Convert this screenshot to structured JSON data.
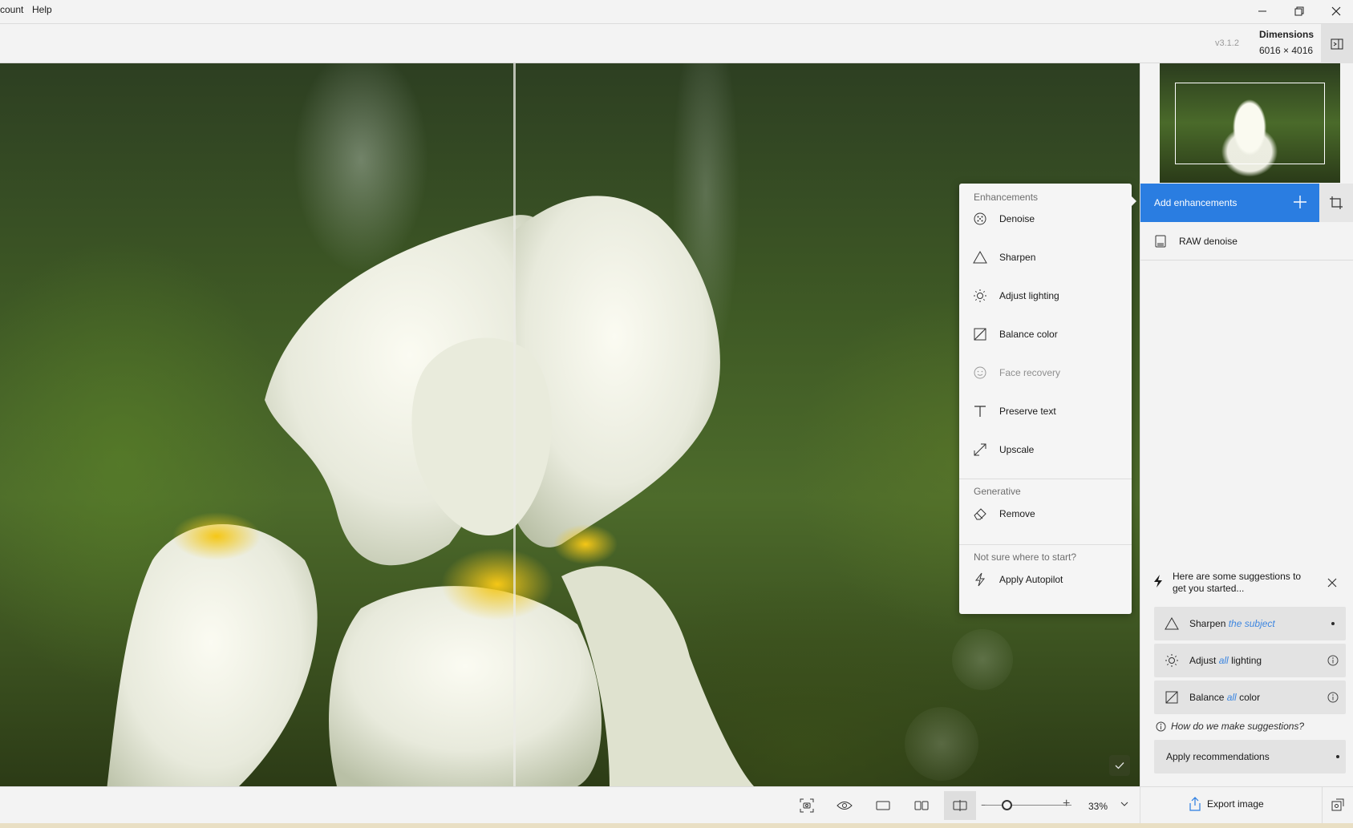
{
  "menubar": {
    "items": [
      "count",
      "Help"
    ]
  },
  "toolbar": {
    "version": "v3.1.2",
    "dimensions_title": "Dimensions",
    "dimensions_value": "6016 × 4016"
  },
  "enhancements_menu": {
    "section_enhancements": "Enhancements",
    "items": [
      {
        "label": "Denoise",
        "icon": "denoise-icon",
        "enabled": true
      },
      {
        "label": "Sharpen",
        "icon": "sharpen-icon",
        "enabled": true
      },
      {
        "label": "Adjust lighting",
        "icon": "lighting-icon",
        "enabled": true
      },
      {
        "label": "Balance color",
        "icon": "balance-color-icon",
        "enabled": true
      },
      {
        "label": "Face recovery",
        "icon": "face-icon",
        "enabled": false
      },
      {
        "label": "Preserve text",
        "icon": "text-icon",
        "enabled": true
      },
      {
        "label": "Upscale",
        "icon": "upscale-icon",
        "enabled": true
      }
    ],
    "section_generative": "Generative",
    "generative_items": [
      {
        "label": "Remove",
        "icon": "eraser-icon"
      }
    ],
    "section_help": "Not sure where to start?",
    "autopilot_label": "Apply Autopilot"
  },
  "right_panel": {
    "add_enhancements_label": "Add enhancements",
    "applied": [
      {
        "label": "RAW denoise",
        "icon": "raw-file-icon"
      }
    ],
    "suggestions_heading": "Here are some suggestions to get you started...",
    "suggestions": [
      {
        "verb": "Sharpen",
        "scope": "the subject",
        "rest": ""
      },
      {
        "verb": "Adjust",
        "scope": "all",
        "rest": "lighting"
      },
      {
        "verb": "Balance",
        "scope": "all",
        "rest": "color"
      }
    ],
    "how_link": "How do we make suggestions?",
    "apply_recommendations": "Apply recommendations",
    "export_label": "Export image"
  },
  "bottombar": {
    "zoom_percent": "33%",
    "zoom_level": 0.25
  },
  "colors": {
    "accent": "#2a7de1",
    "suggestion_scope": "#3d86e0"
  }
}
